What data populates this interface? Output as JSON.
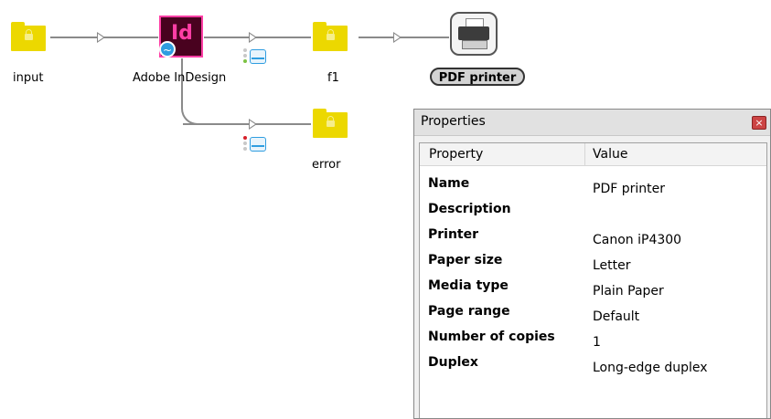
{
  "flow": {
    "nodes": {
      "input": {
        "label": "input"
      },
      "indesign": {
        "label": "Adobe InDesign",
        "icon_text": "Id"
      },
      "f1": {
        "label": "f1"
      },
      "printer": {
        "label": "PDF printer"
      },
      "error": {
        "label": "error"
      }
    }
  },
  "properties_panel": {
    "title": "Properties",
    "close_glyph": "×",
    "columns": {
      "property": "Property",
      "value": "Value"
    },
    "rows": [
      {
        "key": "Name",
        "value": "PDF printer"
      },
      {
        "key": "Description",
        "value": ""
      },
      {
        "key": "Printer",
        "value": "Canon iP4300"
      },
      {
        "key": "Paper size",
        "value": "Letter"
      },
      {
        "key": "Media type",
        "value": "Plain Paper"
      },
      {
        "key": "Page range",
        "value": "Default"
      },
      {
        "key": "Number of copies",
        "value": "1"
      },
      {
        "key": "Duplex",
        "value": "Long-edge duplex"
      }
    ]
  },
  "colors": {
    "folder": "#ecd800",
    "indesign_bg": "#49021f",
    "indesign_accent": "#ff3ea5",
    "status_blue": "#2f9de0",
    "status_ok": "#7cc243",
    "status_error": "#d6202a"
  },
  "icons": [
    "lock-folder-icon",
    "indesign-icon",
    "printer-icon",
    "status-tray-icon",
    "close-icon"
  ]
}
